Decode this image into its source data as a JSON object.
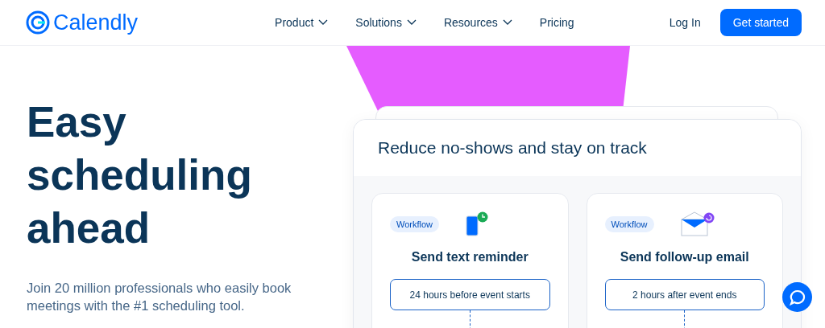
{
  "header": {
    "logo": "Calendly",
    "nav": [
      {
        "label": "Product",
        "dropdown": true
      },
      {
        "label": "Solutions",
        "dropdown": true
      },
      {
        "label": "Resources",
        "dropdown": true
      },
      {
        "label": "Pricing",
        "dropdown": false
      }
    ],
    "login": "Log In",
    "cta": "Get started"
  },
  "hero": {
    "title": "Easy scheduling ahead",
    "subtitle": "Join 20 million professionals who easily book meetings with the #1 scheduling tool."
  },
  "panel": {
    "title": "Reduce no-shows and stay on track",
    "cards": [
      {
        "kind": "text",
        "tag": "Workflow",
        "title": "Send text reminder",
        "timing": "24 hours before event starts"
      },
      {
        "kind": "email",
        "tag": "Workflow",
        "title": "Send follow-up email",
        "timing": "2 hours after event ends"
      }
    ]
  }
}
